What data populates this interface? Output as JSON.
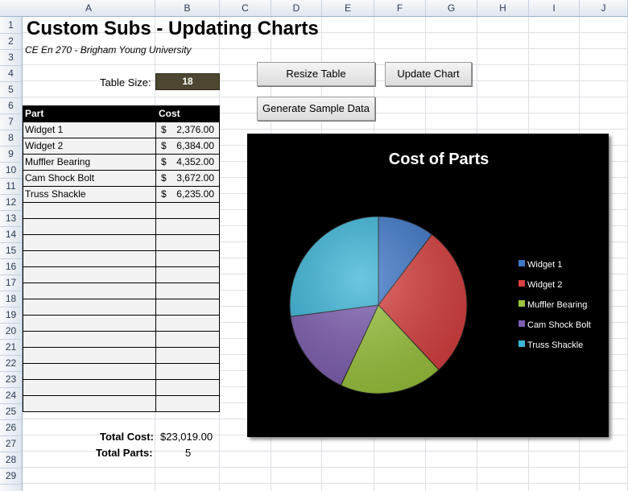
{
  "columns": [
    "A",
    "B",
    "C",
    "D",
    "E",
    "F",
    "G",
    "H",
    "I",
    "J"
  ],
  "rows": [
    "1",
    "2",
    "3",
    "4",
    "5",
    "6",
    "7",
    "8",
    "9",
    "10",
    "11",
    "12",
    "13",
    "14",
    "15",
    "16",
    "17",
    "18",
    "19",
    "20",
    "21",
    "22",
    "23",
    "24",
    "25",
    "26",
    "27",
    "28",
    "29"
  ],
  "sheet": {
    "title": "Custom Subs - Updating Charts",
    "subtitle": "CE En 270 - Brigham Young University",
    "table_size_label": "Table Size:",
    "table_size_value": "18"
  },
  "buttons": {
    "resize": "Resize Table",
    "update": "Update Chart",
    "sample": "Generate Sample Data"
  },
  "table": {
    "headers": [
      "Part",
      "Cost"
    ],
    "rows": [
      {
        "part": "Widget 1",
        "currency": "$",
        "cost": "2,376.00"
      },
      {
        "part": "Widget 2",
        "currency": "$",
        "cost": "6,384.00"
      },
      {
        "part": "Muffler Bearing",
        "currency": "$",
        "cost": "4,352.00"
      },
      {
        "part": "Cam Shock Bolt",
        "currency": "$",
        "cost": "3,672.00"
      },
      {
        "part": "Truss Shackle",
        "currency": "$",
        "cost": "6,235.00"
      },
      {
        "part": "",
        "currency": "",
        "cost": ""
      },
      {
        "part": "",
        "currency": "",
        "cost": ""
      },
      {
        "part": "",
        "currency": "",
        "cost": ""
      },
      {
        "part": "",
        "currency": "",
        "cost": ""
      },
      {
        "part": "",
        "currency": "",
        "cost": ""
      },
      {
        "part": "",
        "currency": "",
        "cost": ""
      },
      {
        "part": "",
        "currency": "",
        "cost": ""
      },
      {
        "part": "",
        "currency": "",
        "cost": ""
      },
      {
        "part": "",
        "currency": "",
        "cost": ""
      },
      {
        "part": "",
        "currency": "",
        "cost": ""
      },
      {
        "part": "",
        "currency": "",
        "cost": ""
      },
      {
        "part": "",
        "currency": "",
        "cost": ""
      },
      {
        "part": "",
        "currency": "",
        "cost": ""
      }
    ]
  },
  "totals": {
    "cost_label": "Total Cost:",
    "cost_value": "$23,019.00",
    "parts_label": "Total Parts:",
    "parts_value": "5"
  },
  "chart_data": {
    "type": "pie",
    "title": "Cost of Parts",
    "categories": [
      "Widget 1",
      "Widget 2",
      "Muffler Bearing",
      "Cam Shock Bolt",
      "Truss Shackle"
    ],
    "values": [
      2376,
      6384,
      4352,
      3672,
      6235
    ],
    "colors": [
      "#3d78c9",
      "#d94040",
      "#9bc43c",
      "#7d5db0",
      "#3bb5d8"
    ],
    "legend_position": "right"
  }
}
